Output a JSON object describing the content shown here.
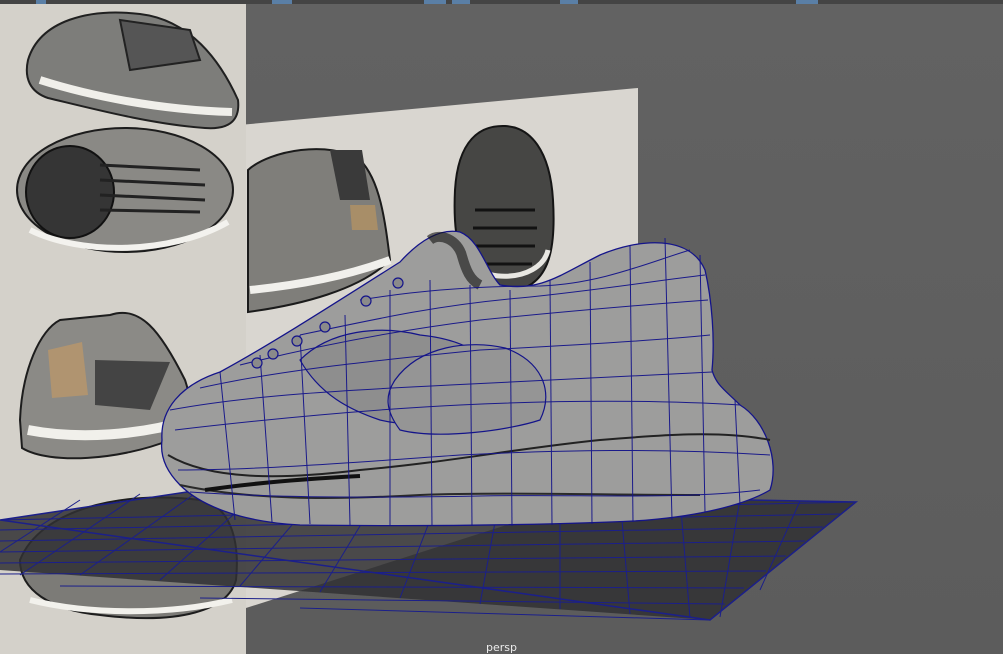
{
  "viewport": {
    "camera_label": "persp"
  },
  "colors": {
    "background": "#5f5f5f",
    "image_plane": "#d6d3cc",
    "wireframe": "#1a1a9a",
    "mesh_shading": "#9c9c9c",
    "grid_line": "#1b1f8a"
  },
  "icons": [
    "toolbar-button-icon"
  ]
}
